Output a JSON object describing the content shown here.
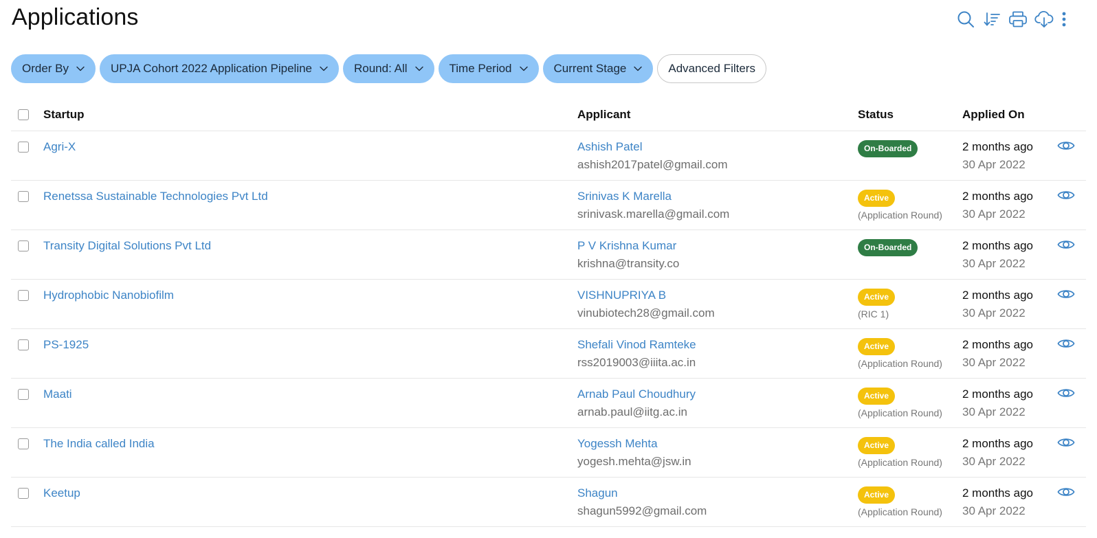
{
  "header": {
    "title": "Applications",
    "icons": [
      "search-icon",
      "sort-icon",
      "print-icon",
      "download-cloud-icon",
      "more-vertical-icon"
    ],
    "accent_color": "#3d84c6"
  },
  "filters": [
    {
      "label": "Order By",
      "type": "dropdown"
    },
    {
      "label": "UPJA Cohort 2022 Application Pipeline",
      "type": "dropdown"
    },
    {
      "label": "Round: All",
      "type": "dropdown"
    },
    {
      "label": "Time Period",
      "type": "dropdown"
    },
    {
      "label": "Current Stage",
      "type": "dropdown"
    },
    {
      "label": "Advanced Filters",
      "type": "button"
    }
  ],
  "table": {
    "columns": [
      "Startup",
      "Applicant",
      "Status",
      "Applied On"
    ],
    "rows": [
      {
        "startup": "Agri-X",
        "applicant_name": "Ashish Patel",
        "applicant_email": "ashish2017patel@gmail.com",
        "status": "On-Boarded",
        "status_color": "#2f7d45",
        "status_note": "",
        "applied_relative": "2 months ago",
        "applied_date": "30 Apr 2022"
      },
      {
        "startup": "Renetssa Sustainable Technologies Pvt Ltd",
        "applicant_name": "Srinivas K Marella",
        "applicant_email": "srinivask.marella@gmail.com",
        "status": "Active",
        "status_color": "#f4c20d",
        "status_note": "(Application Round)",
        "applied_relative": "2 months ago",
        "applied_date": "30 Apr 2022"
      },
      {
        "startup": "Transity Digital Solutions Pvt Ltd",
        "applicant_name": "P V Krishna Kumar",
        "applicant_email": "krishna@transity.co",
        "status": "On-Boarded",
        "status_color": "#2f7d45",
        "status_note": "",
        "applied_relative": "2 months ago",
        "applied_date": "30 Apr 2022"
      },
      {
        "startup": "Hydrophobic Nanobiofilm",
        "applicant_name": "VISHNUPRIYA B",
        "applicant_email": "vinubiotech28@gmail.com",
        "status": "Active",
        "status_color": "#f4c20d",
        "status_note": "(RIC 1)",
        "applied_relative": "2 months ago",
        "applied_date": "30 Apr 2022"
      },
      {
        "startup": "PS-1925",
        "applicant_name": "Shefali Vinod Ramteke",
        "applicant_email": "rss2019003@iiita.ac.in",
        "status": "Active",
        "status_color": "#f4c20d",
        "status_note": "(Application Round)",
        "applied_relative": "2 months ago",
        "applied_date": "30 Apr 2022"
      },
      {
        "startup": "Maati",
        "applicant_name": "Arnab Paul Choudhury",
        "applicant_email": "arnab.paul@iitg.ac.in",
        "status": "Active",
        "status_color": "#f4c20d",
        "status_note": "(Application Round)",
        "applied_relative": "2 months ago",
        "applied_date": "30 Apr 2022"
      },
      {
        "startup": "The India called India",
        "applicant_name": "Yogessh Mehta",
        "applicant_email": "yogesh.mehta@jsw.in",
        "status": "Active",
        "status_color": "#f4c20d",
        "status_note": "(Application Round)",
        "applied_relative": "2 months ago",
        "applied_date": "30 Apr 2022"
      },
      {
        "startup": "Keetup",
        "applicant_name": "Shagun",
        "applicant_email": "shagun5992@gmail.com",
        "status": "Active",
        "status_color": "#f4c20d",
        "status_note": "(Application Round)",
        "applied_relative": "2 months ago",
        "applied_date": "30 Apr 2022"
      }
    ]
  }
}
